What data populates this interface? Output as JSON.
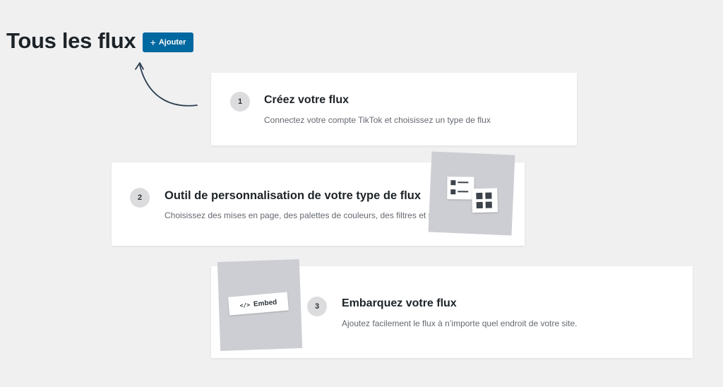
{
  "header": {
    "title": "Tous les flux",
    "add_button_label": "Ajouter"
  },
  "steps": [
    {
      "number": "1",
      "title": "Créez votre flux",
      "description": "Connectez votre compte TikTok et choisissez un type de flux"
    },
    {
      "number": "2",
      "title": "Outil de personnalisation de votre type de flux",
      "description": "Choisissez des mises en page, des palettes de couleurs, des filtres et plus encore"
    },
    {
      "number": "3",
      "title": "Embarquez votre flux",
      "description": "Ajoutez facilement le flux à n’importe quel endroit de votre site."
    }
  ],
  "illustrations": {
    "embed_label": "Embed",
    "embed_icon": "code-icon",
    "layout_icon": "layout-icon"
  },
  "colors": {
    "accent": "#0068a0",
    "background": "#f0f0f1",
    "illustration_bg": "#cdced3"
  }
}
